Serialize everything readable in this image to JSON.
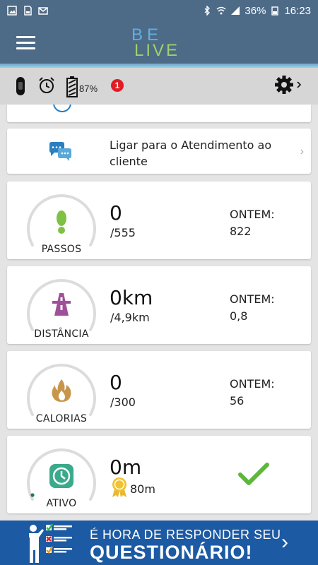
{
  "status_bar": {
    "battery": "36%",
    "time": "16:23",
    "left_icons": [
      "image-icon",
      "sd-card-icon",
      "mail-icon"
    ],
    "right_icons": [
      "bluetooth-icon",
      "wifi-icon",
      "signal-icon"
    ]
  },
  "app_bar": {
    "logo_top": "BE",
    "logo_bottom": "LIVE"
  },
  "device_bar": {
    "battery_percent": "87%",
    "notification_count": "1",
    "icons": [
      "band-icon",
      "alarm-icon",
      "battery-icon",
      "gear-icon"
    ]
  },
  "support": {
    "label": "Ligar para o Atendimento ao cliente"
  },
  "metrics": [
    {
      "label": "PASSOS",
      "value": "0",
      "goal": "/555",
      "yesterday_label": "ONTEM:",
      "yesterday_value": "822",
      "icon": "footprint-icon",
      "color": "#7dc242"
    },
    {
      "label": "DISTÂNCIA",
      "value": "0km",
      "goal": "/4,9km",
      "yesterday_label": "ONTEM:",
      "yesterday_value": "0,8",
      "icon": "road-icon",
      "color": "#a0509a"
    },
    {
      "label": "CALORIAS",
      "value": "0",
      "goal": "/300",
      "yesterday_label": "ONTEM:",
      "yesterday_value": "56",
      "icon": "flame-icon",
      "color": "#c8964a"
    },
    {
      "label": "ATIVO",
      "value": "0m",
      "goal": "80m",
      "icon": "clock-icon",
      "color": "#3aaa8c",
      "status_icon": "checkmark-icon"
    }
  ],
  "banner": {
    "line1": "É HORA DE RESPONDER SEU",
    "line2": "QUESTIONÁRIO!"
  },
  "colors": {
    "header": "#4d6a86",
    "banner": "#1c5aa4",
    "check": "#5cb83a"
  }
}
